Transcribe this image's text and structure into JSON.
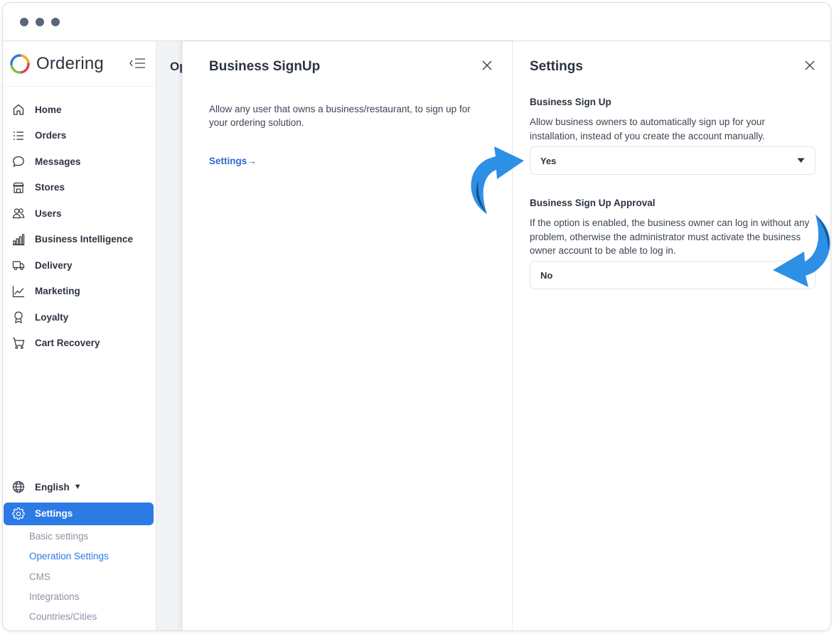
{
  "sidebar": {
    "brand": "Ordering",
    "items": [
      {
        "label": "Home",
        "icon": "home-icon"
      },
      {
        "label": "Orders",
        "icon": "list-icon"
      },
      {
        "label": "Messages",
        "icon": "chat-icon"
      },
      {
        "label": "Stores",
        "icon": "store-icon"
      },
      {
        "label": "Users",
        "icon": "users-icon"
      },
      {
        "label": "Business Intelligence",
        "icon": "bar-chart-icon"
      },
      {
        "label": "Delivery",
        "icon": "truck-icon"
      },
      {
        "label": "Marketing",
        "icon": "line-chart-icon"
      },
      {
        "label": "Loyalty",
        "icon": "award-icon"
      },
      {
        "label": "Cart Recovery",
        "icon": "cart-icon"
      }
    ],
    "language": "English",
    "settings": "Settings",
    "subitems": [
      "Basic settings",
      "Operation Settings",
      "CMS",
      "Integrations",
      "Countries/Cities"
    ]
  },
  "background_page": {
    "title": "Operation Settings"
  },
  "business_signup": {
    "title": "Business SignUp",
    "description": "Allow any user that owns a business/restaurant, to sign up for your ordering solution.",
    "settings_link": "Settings"
  },
  "settings_panel": {
    "title": "Settings",
    "sign_up": {
      "label": "Business Sign Up",
      "description": "Allow business owners to automatically sign up for your installation, instead of you create the account manually.",
      "value": "Yes"
    },
    "approval": {
      "label": "Business Sign Up Approval",
      "description": "If the option is enabled, the business owner can log in without any problem, otherwise the administrator must activate the business owner account to be able to log in.",
      "value": "No"
    }
  },
  "colors": {
    "accent": "#2c7be5",
    "arrow_light": "#2e8fe6",
    "arrow_dark": "#174f86"
  }
}
